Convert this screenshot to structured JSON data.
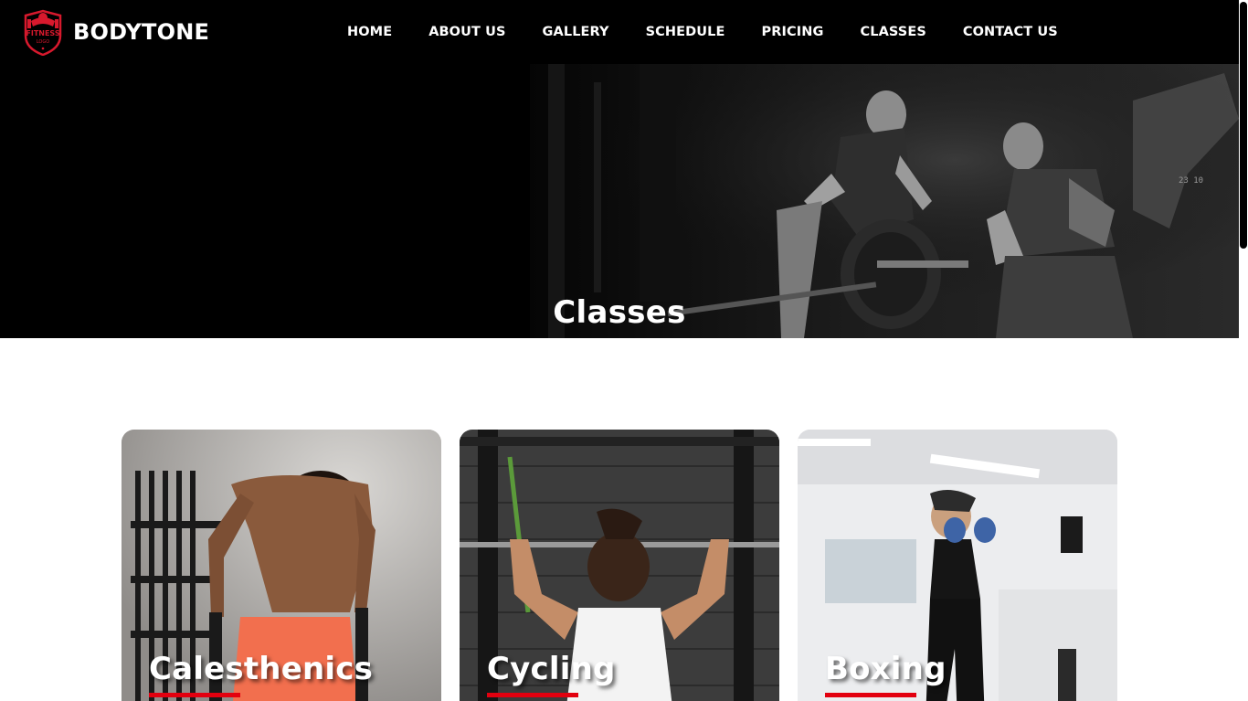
{
  "brand": {
    "name": "BODYTONE",
    "logo_text_top": "FITNESS",
    "logo_text_bottom": "LOGO",
    "accent_color": "#d7192d"
  },
  "nav": {
    "items": [
      {
        "label": "HOME"
      },
      {
        "label": "ABOUT US"
      },
      {
        "label": "GALLERY"
      },
      {
        "label": "SCHEDULE"
      },
      {
        "label": "PRICING"
      },
      {
        "label": "CLASSES"
      },
      {
        "label": "CONTACT US"
      }
    ]
  },
  "hero": {
    "title": "Classes",
    "photo_description_icon": "gym-deadlift-photo"
  },
  "classes": {
    "cards": [
      {
        "title": "Calesthenics",
        "image_icon": "dips-photo"
      },
      {
        "title": "Cycling",
        "image_icon": "pullup-bar-photo"
      },
      {
        "title": "Boxing",
        "image_icon": "boxing-photo"
      }
    ],
    "underline_color": "#e3000f"
  }
}
